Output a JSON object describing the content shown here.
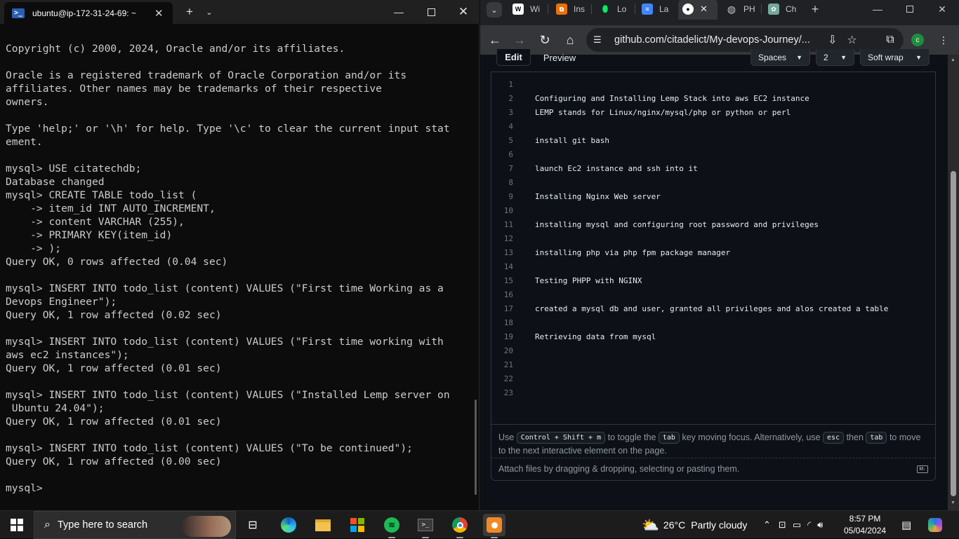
{
  "terminal": {
    "tab_title": "ubuntu@ip-172-31-24-69: ~",
    "lines": [
      "Copyright (c) 2000, 2024, Oracle and/or its affiliates.",
      "",
      "Oracle is a registered trademark of Oracle Corporation and/or its",
      "affiliates. Other names may be trademarks of their respective",
      "owners.",
      "",
      "Type 'help;' or '\\h' for help. Type '\\c' to clear the current input stat",
      "ement.",
      "",
      "mysql> USE citatechdb;",
      "Database changed",
      "mysql> CREATE TABLE todo_list (",
      "    -> item_id INT AUTO_INCREMENT,",
      "    -> content VARCHAR (255),",
      "    -> PRIMARY KEY(item_id)",
      "    -> );",
      "Query OK, 0 rows affected (0.04 sec)",
      "",
      "mysql> INSERT INTO todo_list (content) VALUES (\"First time Working as a",
      "Devops Engineer\");",
      "Query OK, 1 row affected (0.02 sec)",
      "",
      "mysql> INSERT INTO todo_list (content) VALUES (\"First time working with",
      "aws ec2 instances\");",
      "Query OK, 1 row affected (0.01 sec)",
      "",
      "mysql> INSERT INTO todo_list (content) VALUES (\"Installed Lemp server on",
      " Ubuntu 24.04\");",
      "Query OK, 1 row affected (0.01 sec)",
      "",
      "mysql> INSERT INTO todo_list (content) VALUES (\"To be continued\");",
      "Query OK, 1 row affected (0.00 sec)",
      "",
      "mysql> "
    ]
  },
  "browser": {
    "tabs": [
      {
        "label": "Wi",
        "icon": "wikipedia-icon",
        "color": "#ffffff"
      },
      {
        "label": "Ins",
        "icon": "instance-icon",
        "color": "#e8710a"
      },
      {
        "label": "Lo",
        "icon": "leaf-icon",
        "color": "#00ed64"
      },
      {
        "label": "La",
        "icon": "document-icon",
        "color": "#4285f4"
      },
      {
        "label": "",
        "icon": "github-icon",
        "color": "#ffffff"
      },
      {
        "label": "PH",
        "icon": "globe-icon",
        "color": "#c4c7c5"
      },
      {
        "label": "Ch",
        "icon": "chatgpt-icon",
        "color": "#74aa9c"
      }
    ],
    "url": "github.com/citadelict/My-devops-Journey/...",
    "profile_initial": "c"
  },
  "editor": {
    "tab_edit": "Edit",
    "tab_preview": "Preview",
    "indent_mode": "Spaces",
    "indent_size": "2",
    "wrap_mode": "Soft wrap",
    "lines": [
      {
        "n": "1",
        "text": ""
      },
      {
        "n": "2",
        "text": "Configuring and Installing Lemp Stack into aws EC2 instance"
      },
      {
        "n": "3",
        "text": "LEMP stands for Linux/nginx/mysql/php or python or perl"
      },
      {
        "n": "4",
        "text": ""
      },
      {
        "n": "5",
        "text": "install git bash"
      },
      {
        "n": "6",
        "text": ""
      },
      {
        "n": "7",
        "text": "launch Ec2 instance and ssh into it"
      },
      {
        "n": "8",
        "text": ""
      },
      {
        "n": "9",
        "text": "Installing Nginx Web server"
      },
      {
        "n": "10",
        "text": ""
      },
      {
        "n": "11",
        "text": "installing mysql and configuring root password and privileges"
      },
      {
        "n": "12",
        "text": ""
      },
      {
        "n": "13",
        "text": "installing php via php fpm package manager"
      },
      {
        "n": "14",
        "text": ""
      },
      {
        "n": "15",
        "text": "Testing PHPP with NGINX"
      },
      {
        "n": "16",
        "text": ""
      },
      {
        "n": "17",
        "text": "created a mysql db and user, granted all privileges and alos created a table"
      },
      {
        "n": "18",
        "text": ""
      },
      {
        "n": "19",
        "text": "Retrieving data from mysql"
      },
      {
        "n": "20",
        "text": ""
      },
      {
        "n": "21",
        "text": ""
      },
      {
        "n": "22",
        "text": ""
      },
      {
        "n": "23",
        "text": ""
      }
    ],
    "hint_use": "Use",
    "hint_kbd1": "Control + Shift + m",
    "hint_toggle": "to toggle the",
    "hint_kbd_tab": "tab",
    "hint_mid": "key moving focus. Alternatively, use",
    "hint_kbd_esc": "esc",
    "hint_then": "then",
    "hint_to": "to",
    "hint_end": "move to the next interactive element on the page.",
    "attach_text": "Attach files by dragging & dropping, selecting or pasting them.",
    "md_badge": "M↓"
  },
  "taskbar": {
    "search_placeholder": "Type here to search",
    "weather_temp": "26°C",
    "weather_desc": "Partly cloudy",
    "time": "8:57 PM",
    "date": "05/04/2024"
  }
}
